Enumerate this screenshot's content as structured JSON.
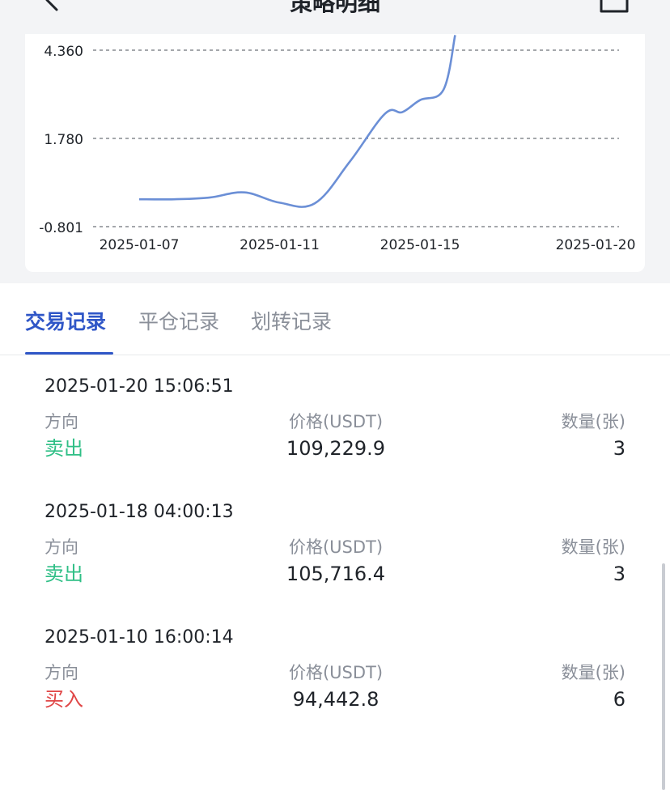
{
  "header": {
    "title": "策略明细"
  },
  "chart_data": {
    "type": "line",
    "y_ticks": [
      "4.360",
      "1.780",
      "-0.801"
    ],
    "y_tick_values": [
      4.36,
      1.78,
      -0.801
    ],
    "x_ticks": [
      "2025-01-07",
      "2025-01-11",
      "2025-01-15",
      "2025-01-20"
    ],
    "ylim": [
      -0.801,
      4.36
    ],
    "grid": true,
    "legend": "none",
    "line_color": "#6b8fd6",
    "series": [
      {
        "x": [
          "2025-01-07",
          "2025-01-08",
          "2025-01-09",
          "2025-01-10",
          "2025-01-11",
          "2025-01-12",
          "2025-01-13",
          "2025-01-14",
          "2025-01-14T12:00",
          "2025-01-15",
          "2025-01-15T16:00",
          "2025-01-16"
        ],
        "values": [
          0.0,
          0.0,
          0.05,
          0.2,
          -0.1,
          -0.12,
          1.1,
          2.5,
          2.55,
          2.9,
          3.2,
          4.8
        ]
      }
    ]
  },
  "tabs": [
    {
      "label": "交易记录",
      "active": true
    },
    {
      "label": "平仓记录",
      "active": false
    },
    {
      "label": "划转记录",
      "active": false
    }
  ],
  "columns": {
    "direction": "方向",
    "price": "价格(USDT)",
    "qty": "数量(张)"
  },
  "trades": [
    {
      "time": "2025-01-20 15:06:51",
      "direction": "卖出",
      "side": "sell",
      "price": "109,229.9",
      "qty": "3"
    },
    {
      "time": "2025-01-18 04:00:13",
      "direction": "卖出",
      "side": "sell",
      "price": "105,716.4",
      "qty": "3"
    },
    {
      "time": "2025-01-10 16:00:14",
      "direction": "买入",
      "side": "buy",
      "price": "94,442.8",
      "qty": "6"
    }
  ],
  "colors": {
    "accent": "#2f56c7",
    "sell": "#2fbf86",
    "buy": "#e04646"
  }
}
